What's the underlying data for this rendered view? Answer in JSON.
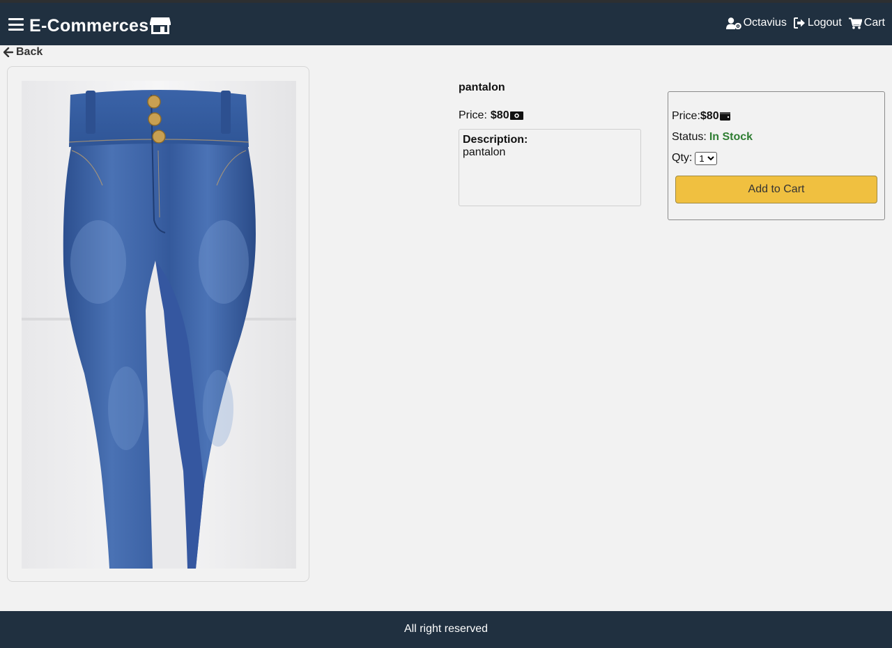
{
  "header": {
    "brand": "E-Commerces",
    "user_name": "Octavius",
    "logout_label": "Logout",
    "cart_label": "Cart",
    "icons": [
      "menu-icon",
      "store-icon",
      "user-gear-icon",
      "sign-out-icon",
      "shopping-cart-icon"
    ]
  },
  "back_label": "Back",
  "product": {
    "name": "pantalon",
    "price_label": "Price:",
    "price_value": "$80",
    "description_label": "Description:",
    "description_text": "pantalon",
    "image_subject": "blue denim high-waist jeans"
  },
  "cart_box": {
    "price_label": "Price:",
    "price_value": "$80",
    "status_label": "Status:",
    "status_value": "In Stock",
    "qty_label": "Qty:",
    "qty_value": "1",
    "add_button_label": "Add to Cart"
  },
  "footer": {
    "text": "All right reserved"
  },
  "colors": {
    "header_bg": "#203040",
    "page_bg": "#f2f2f2",
    "in_stock": "#2e7d32",
    "add_button": "#f0c040"
  }
}
